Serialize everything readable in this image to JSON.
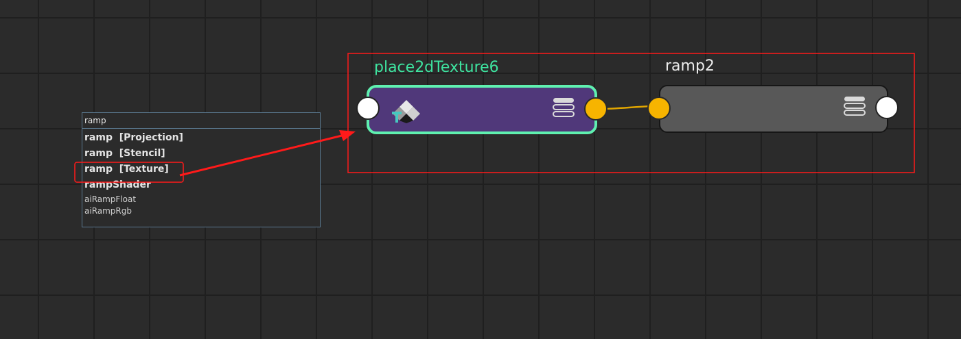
{
  "search": {
    "value": "ramp",
    "results": [
      {
        "label": "ramp  [Projection]",
        "style": "bold"
      },
      {
        "label": "ramp  [Stencil]",
        "style": "bold"
      },
      {
        "label": "ramp  [Texture]",
        "style": "bold",
        "highlighted": true
      },
      {
        "label": "rampShader",
        "style": "bold"
      },
      {
        "label": "aiRampFloat",
        "style": "small"
      },
      {
        "label": "aiRampRgb",
        "style": "small"
      }
    ]
  },
  "nodes": [
    {
      "title": "place2dTexture6",
      "title_color": "#3ee4a0",
      "body_color": "#50387a",
      "border_color": "#5ff0b0",
      "icon": "place2d-texture-icon"
    },
    {
      "title": "ramp2",
      "title_color": "#ececec",
      "body_color": "#585858"
    }
  ],
  "connection": {
    "from": "place2dTexture6",
    "to": "ramp2",
    "color": "#e0a500"
  },
  "annotation": {
    "color": "#ff1a1a"
  },
  "icons": [
    "place2d-texture-icon",
    "attribute-stack-icon",
    "arrow-annotation"
  ]
}
